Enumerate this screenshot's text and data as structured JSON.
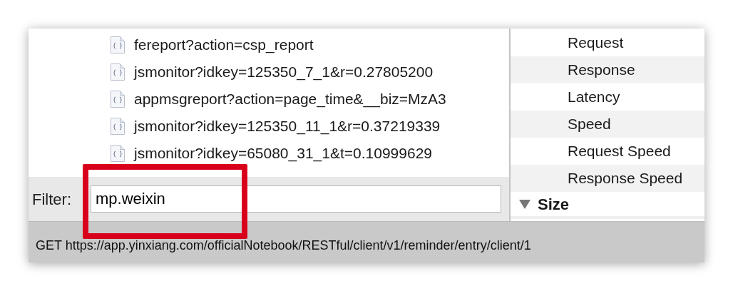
{
  "requests": [
    {
      "label": "fereport?action=csp_report"
    },
    {
      "label": "jsmonitor?idkey=125350_7_1&r=0.27805200"
    },
    {
      "label": "appmsgreport?action=page_time&__biz=MzA3"
    },
    {
      "label": "jsmonitor?idkey=125350_11_1&r=0.37219339"
    },
    {
      "label": "jsmonitor?idkey=65080_31_1&t=0.10999629"
    }
  ],
  "filter": {
    "label": "Filter:",
    "value": "mp.weixin"
  },
  "details": {
    "rows": [
      {
        "label": "Request"
      },
      {
        "label": "Response"
      },
      {
        "label": "Latency"
      },
      {
        "label": "Speed"
      },
      {
        "label": "Request Speed"
      },
      {
        "label": "Response Speed"
      }
    ],
    "section": {
      "label": "Size",
      "expanded": true
    }
  },
  "status_bar": "GET https://app.yinxiang.com/officialNotebook/RESTful/client/v1/reminder/entry/client/1"
}
